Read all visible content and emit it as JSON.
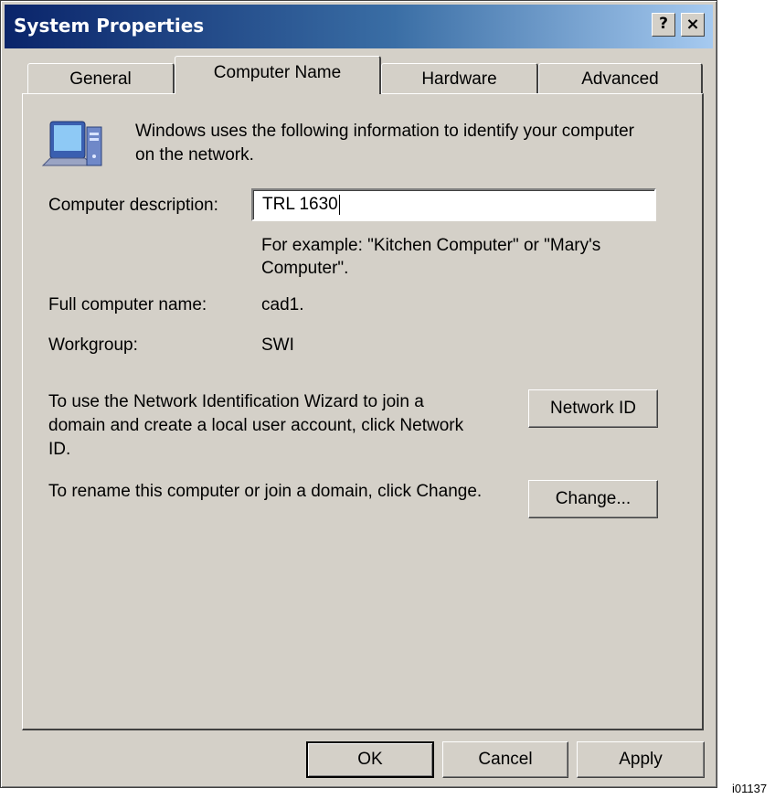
{
  "window": {
    "title": "System Properties",
    "help_glyph": "?",
    "close_glyph": "×"
  },
  "tabs": [
    {
      "label": "General",
      "selected": false
    },
    {
      "label": "Computer Name",
      "selected": true
    },
    {
      "label": "Hardware",
      "selected": false
    },
    {
      "label": "Advanced",
      "selected": false
    }
  ],
  "panel": {
    "icon": "network-computer-icon",
    "intro_line1": "Windows uses the following information to identify your computer",
    "intro_line2": "on the network.",
    "description_label": "Computer description:",
    "description_value": "TRL 1630",
    "example_line1": "For example: \"Kitchen Computer\" or \"Mary's",
    "example_line2": "Computer\".",
    "full_name_label": "Full computer name:",
    "full_name_value": "cad1.",
    "workgroup_label": "Workgroup:",
    "workgroup_value": "SWI",
    "network_text_line1": "To use the Network Identification Wizard to join a",
    "network_text_line2": "domain and create a local user account, click Network",
    "network_text_line3": "ID.",
    "network_id_button": "Network ID",
    "rename_text": "To rename this computer or join a domain, click Change.",
    "change_button": "Change..."
  },
  "footer": {
    "ok": "OK",
    "cancel": "Cancel",
    "apply": "Apply"
  },
  "figure_id": "i01137"
}
